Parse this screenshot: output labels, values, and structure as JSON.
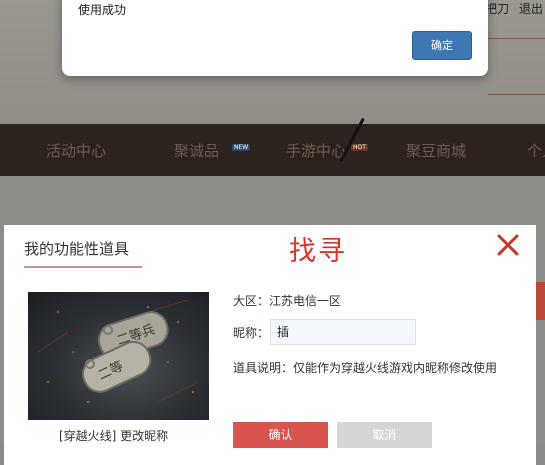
{
  "top_links": [
    "把刀",
    "退出"
  ],
  "alert": {
    "message": "使用成功",
    "ok_label": "确定"
  },
  "nav": {
    "items": [
      "活动中心",
      "聚诚品",
      "手游中心",
      "聚豆商城",
      "个人"
    ],
    "badges": {
      "new": "NEW",
      "hot": "HOT"
    }
  },
  "dialog": {
    "title": "我的功能性道具",
    "heading": "找寻",
    "item_name": "[穿越火线] 更改昵称",
    "region_label": "大区：",
    "region_value": "江苏电信一区",
    "nickname_label": "昵称：",
    "nickname_value": "插",
    "description": "道具说明：仅能作为穿越火线游戏内昵称修改使用",
    "confirm_label": "确认",
    "cancel_label": "取消",
    "image_tag_text": "二等兵"
  },
  "colors": {
    "alert_button": "#3d76b1",
    "heading": "#d9342b",
    "close_icon": "#c0392b",
    "confirm_button": "#d9534f",
    "cancel_button": "#d6d6d6"
  }
}
